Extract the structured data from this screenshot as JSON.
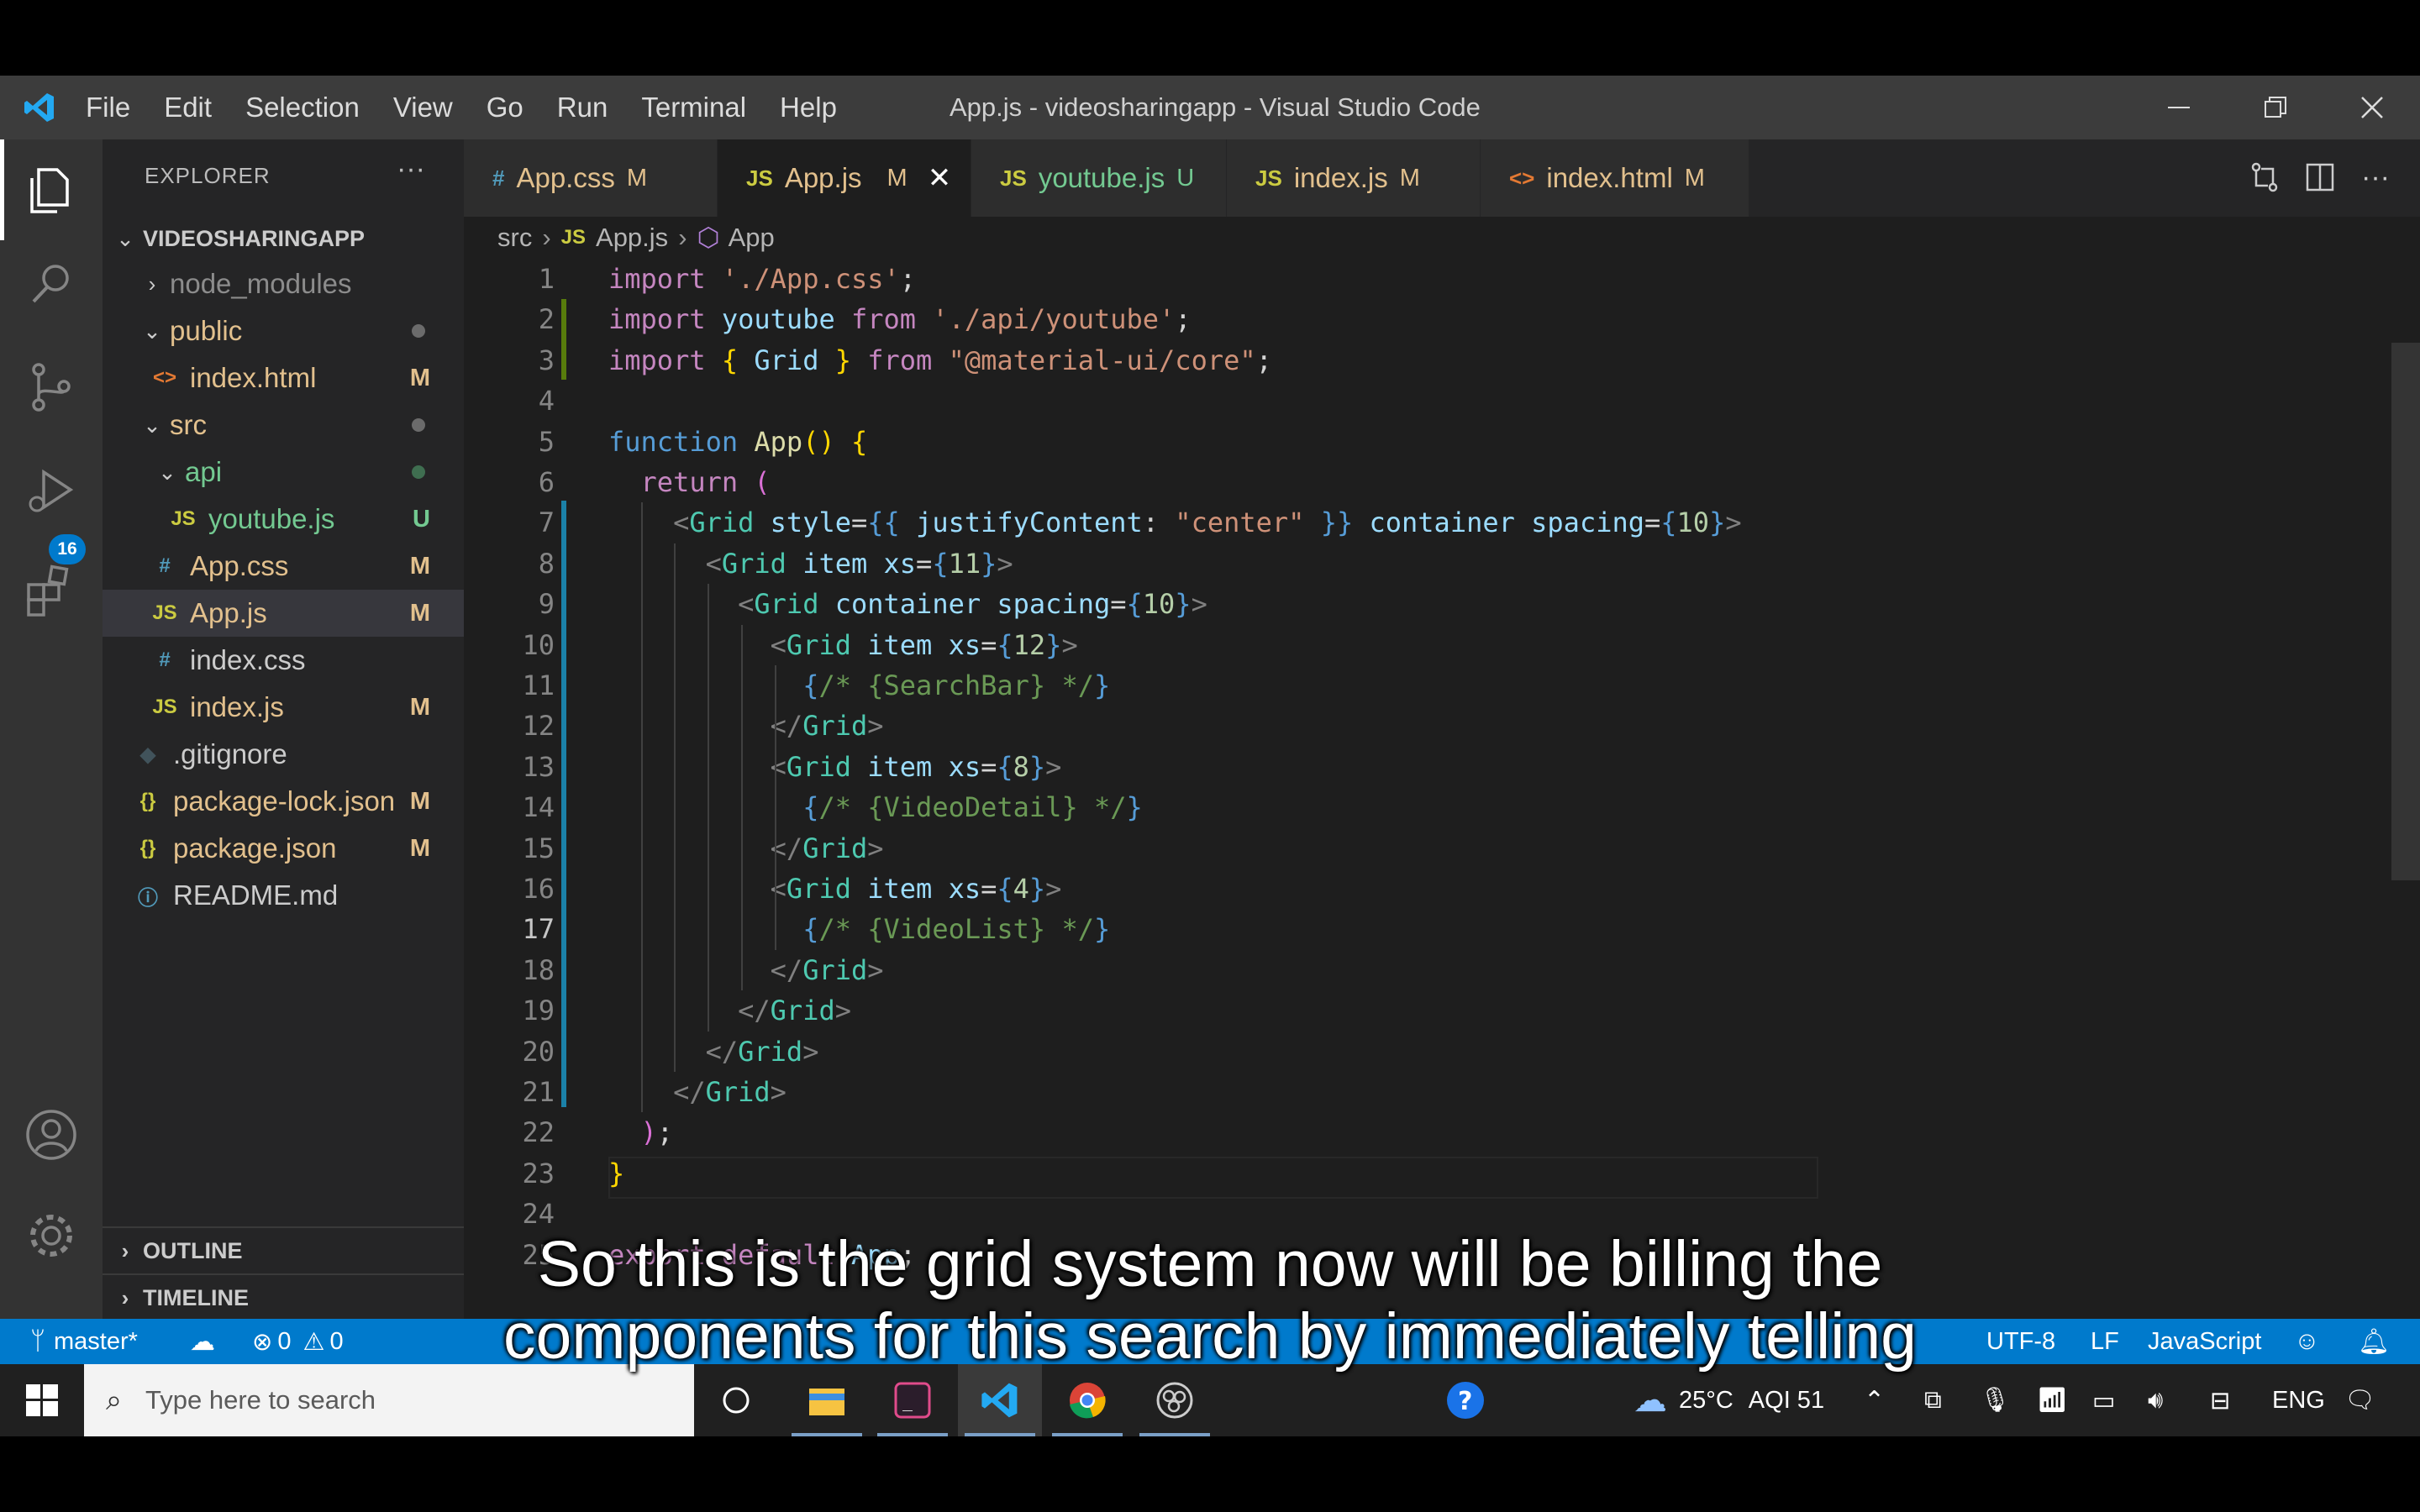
{
  "window": {
    "title": "App.js - videosharingapp - Visual Studio Code",
    "menu": [
      "File",
      "Edit",
      "Selection",
      "View",
      "Go",
      "Run",
      "Terminal",
      "Help"
    ]
  },
  "activity_bar": {
    "items": [
      "explorer-icon",
      "search-icon",
      "source-control-icon",
      "run-debug-icon",
      "extensions-icon"
    ],
    "source_control_badge": "16",
    "bottom": [
      "account-icon",
      "settings-gear-icon"
    ]
  },
  "explorer": {
    "header": "EXPLORER",
    "more": "···",
    "root": "VIDEOSHARINGAPP",
    "tree": [
      {
        "label": "node_modules",
        "icon": ">",
        "status": ""
      },
      {
        "label": "public",
        "icon": "v",
        "status": "dot"
      },
      {
        "label": "index.html",
        "icon": "<>",
        "status": "M"
      },
      {
        "label": "src",
        "icon": "v",
        "status": "dot"
      },
      {
        "label": "api",
        "icon": "v",
        "status": "dot"
      },
      {
        "label": "youtube.js",
        "icon": "JS",
        "status": "U"
      },
      {
        "label": "App.css",
        "icon": "#",
        "status": "M"
      },
      {
        "label": "App.js",
        "icon": "JS",
        "status": "M"
      },
      {
        "label": "index.css",
        "icon": "#",
        "status": ""
      },
      {
        "label": "index.js",
        "icon": "JS",
        "status": "M"
      },
      {
        "label": ".gitignore",
        "icon": "git",
        "status": ""
      },
      {
        "label": "package-lock.json",
        "icon": "{}",
        "status": "M"
      },
      {
        "label": "package.json",
        "icon": "{}",
        "status": "M"
      },
      {
        "label": "README.md",
        "icon": "i",
        "status": ""
      }
    ],
    "outline": "OUTLINE",
    "timeline": "TIMELINE"
  },
  "tabs": [
    {
      "label": "App.css",
      "icon": "#",
      "status": "M"
    },
    {
      "label": "App.js",
      "icon": "JS",
      "status": "M",
      "close": "✕"
    },
    {
      "label": "youtube.js",
      "icon": "JS",
      "status": "U"
    },
    {
      "label": "index.js",
      "icon": "JS",
      "status": "M"
    },
    {
      "label": "index.html",
      "icon": "<>",
      "status": "M"
    }
  ],
  "breadcrumb": [
    "src",
    "App.js",
    "App"
  ],
  "breadcrumb_icons": {
    "file": "JS"
  },
  "editor": {
    "current_line": "17",
    "lines": [
      "1",
      "2",
      "3",
      "4",
      "5",
      "6",
      "7",
      "8",
      "9",
      "10",
      "11",
      "12",
      "13",
      "14",
      "15",
      "16",
      "17",
      "18",
      "19",
      "20",
      "21",
      "22",
      "23",
      "24",
      "25"
    ]
  },
  "status_bar": {
    "branch": "master*",
    "errors": "0",
    "warnings": "0",
    "encoding": "UTF-8",
    "eol": "LF",
    "language": "JavaScript"
  },
  "taskbar": {
    "search_placeholder": "Type here to search",
    "weather": "25°C",
    "aqi": "AQI 51",
    "lang": "ENG"
  },
  "subtitle": {
    "line1": "So this is the grid system now will be billing the",
    "line2": "components for this search by immediately telling"
  },
  "colors": {
    "accent": "#007acc",
    "modified": "#e2c08d",
    "untracked": "#73c991",
    "git_added_gutter": "#587c0c",
    "git_modified_gutter": "#1b81a8"
  }
}
